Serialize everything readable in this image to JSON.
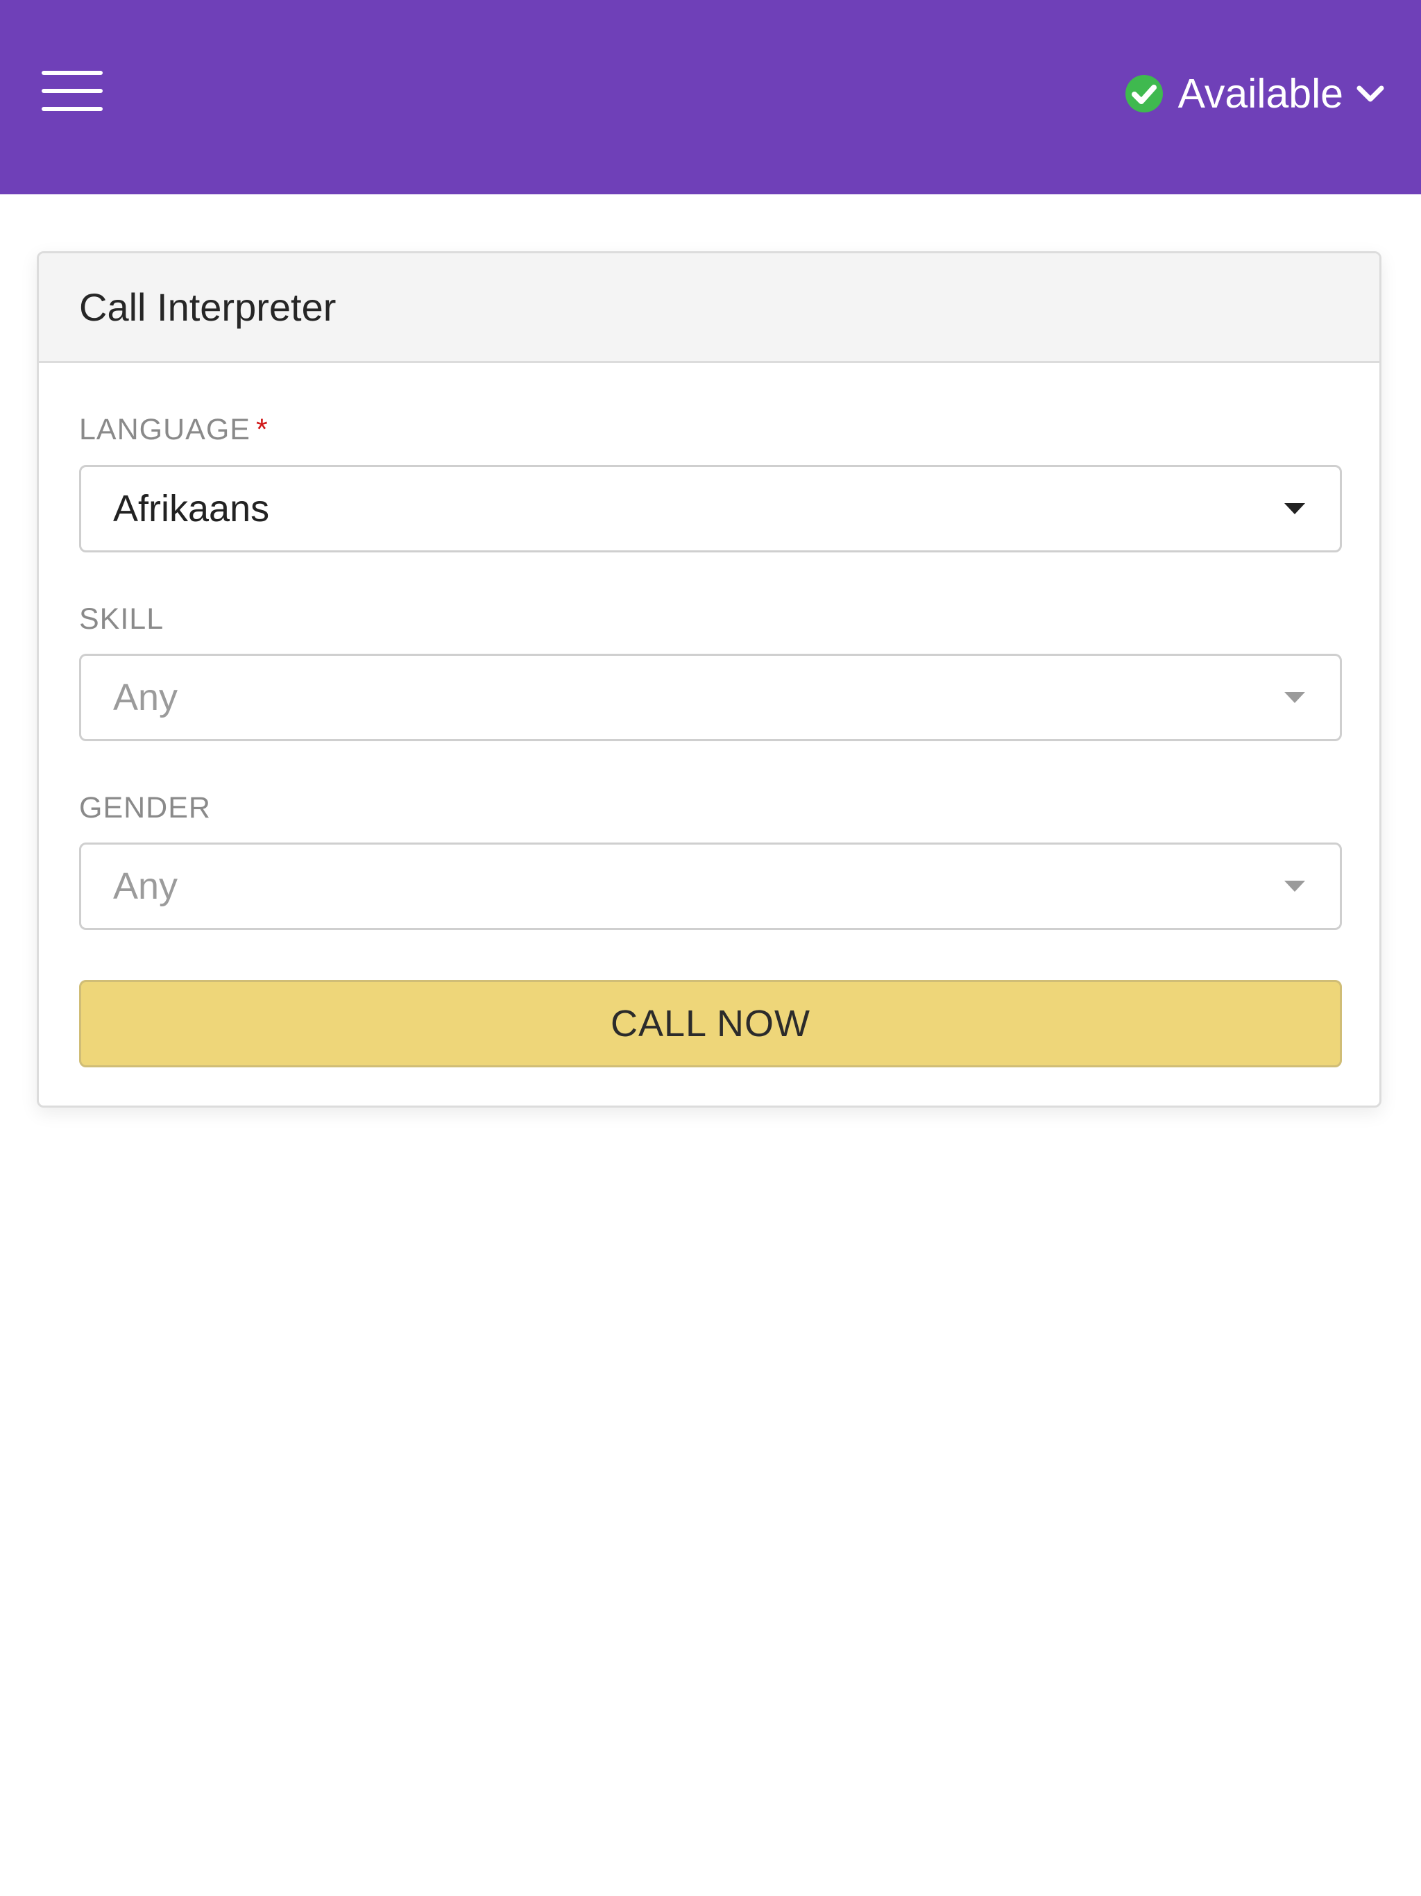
{
  "header": {
    "menu_icon": "hamburger-menu-icon",
    "status": {
      "label": "Available",
      "icon": "check-circle-icon",
      "icon_color": "#3fb94f",
      "dropdown_icon": "chevron-down-icon"
    },
    "background_color": "#6f40b8"
  },
  "card": {
    "title": "Call Interpreter",
    "fields": {
      "language": {
        "label": "LANGUAGE",
        "required_mark": "*",
        "value": "Afrikaans"
      },
      "skill": {
        "label": "SKILL",
        "value": "Any"
      },
      "gender": {
        "label": "GENDER",
        "value": "Any"
      }
    },
    "call_button_label": "CALL NOW",
    "call_button_color": "#eed679"
  }
}
